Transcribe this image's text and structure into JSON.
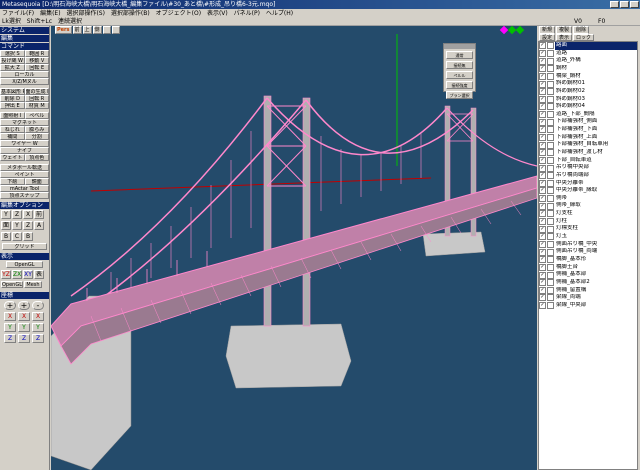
{
  "window": {
    "title": "Metasequoia [D:\\明石海峡大橋\\明石海峡大橋_編集ファイル\\#30_あと橋\\#形成_吊り橋6-3元.mqo]"
  },
  "menu": [
    "ファイル(F)",
    "編集(E)",
    "選択部操作(S)",
    "選択部操作(B)",
    "オブジェクト(O)",
    "表示(V)",
    "パネル(P)",
    "ヘルプ(H)"
  ],
  "cmdbar": {
    "items": [
      "Lk選択",
      "Shift+Lc",
      "連続選択"
    ],
    "v_label": "V0",
    "f_label": "F0"
  },
  "left": {
    "system_title": "システム",
    "edit_title": "編集",
    "command_title": "コマンド",
    "commands": [
      [
        "選択 S",
        "範囲 R"
      ],
      [
        "投げ縄 W",
        "移動 V"
      ],
      [
        "拡大 Z",
        "回転 E"
      ],
      [
        "ローカル",
        "X/Z/Mヌル"
      ],
      [
        "基本図形 P",
        "面の生成 F"
      ],
      [
        "削除 D",
        "回転 R"
      ],
      [
        "押出 E",
        "材質 M"
      ],
      [
        "面照射 I",
        "ペベル"
      ],
      [
        "マグネット",
        "ナイフ"
      ],
      [
        "ねじれ",
        "膨らみ"
      ],
      [
        "補間",
        "分割"
      ],
      [
        "ワイヤー W",
        "ナイフ"
      ],
      [
        "ウェイト",
        "頂点色"
      ],
      [
        "メタボール転送",
        "ペイント"
      ],
      [
        "下絵",
        "鏡面"
      ],
      [
        "mActar Tool",
        "頂点スナップ"
      ]
    ],
    "editopt_title": "編集オプション",
    "editopt_icons": [
      "Y",
      "Z",
      "X",
      "前",
      "面",
      "Y",
      "Z",
      "A",
      "B",
      "C",
      "B"
    ],
    "snap_label": "グリッド",
    "disp_title": "表示",
    "opengl_label": "OpenGL",
    "view_buttons": [
      "YZ",
      "ZX",
      "XY",
      "表"
    ],
    "mesh_label": "Mesh",
    "axis_title": "座標",
    "axis_big": [
      "+",
      "+",
      "-"
    ],
    "axis_rows": [
      [
        "X",
        "X",
        "X"
      ],
      [
        "Y",
        "Y",
        "Y"
      ],
      [
        "Z",
        "Z",
        "Z"
      ]
    ]
  },
  "viewport": {
    "toolbar": [
      "Pers",
      "前",
      "上",
      "側",
      "",
      ""
    ],
    "float_panel": {
      "title": "",
      "buttons": [
        "通常",
        "接続無",
        "ペルル",
        "接続強度",
        "プラン選択"
      ]
    },
    "colors": {
      "bg": "#244b6b",
      "bridge": "#ff88cc",
      "tower_base": "#c8c8c8",
      "green_axis": "#00c000",
      "red_axis": "#c00000"
    }
  },
  "right": {
    "tabs": [
      "新規",
      "複製",
      "削除"
    ],
    "subtabs": [
      "設定",
      "表示",
      "ロック"
    ],
    "objects": [
      "路面",
      "道路",
      "道路_外構",
      "鋼材",
      "橋梁_鋼材",
      "斜め鋼材01",
      "斜め鋼材02",
      "斜め鋼材03",
      "斜め鋼材04",
      "道路_下部_間隔",
      "下部補強材_側面",
      "下部補強材_下面",
      "下部補強材_上面",
      "下部補強材_自転車用",
      "下部補強材_渡し材",
      "下部_自転車道",
      "吊り橋中央部",
      "吊り橋両端部",
      "中央分離帯",
      "中央分離帯_縁取",
      "側帯",
      "側帯_縁取",
      "灯支柱",
      "灯柱",
      "灯標支柱",
      "灯玉",
      "側面吊り橋_中央",
      "側面吊り橋_両端",
      "橋脚_基本形",
      "橋脚土台",
      "側補_基本部",
      "側補_基本部2",
      "側補_留置構",
      "梁線_両端",
      "梁線_中央部"
    ]
  }
}
